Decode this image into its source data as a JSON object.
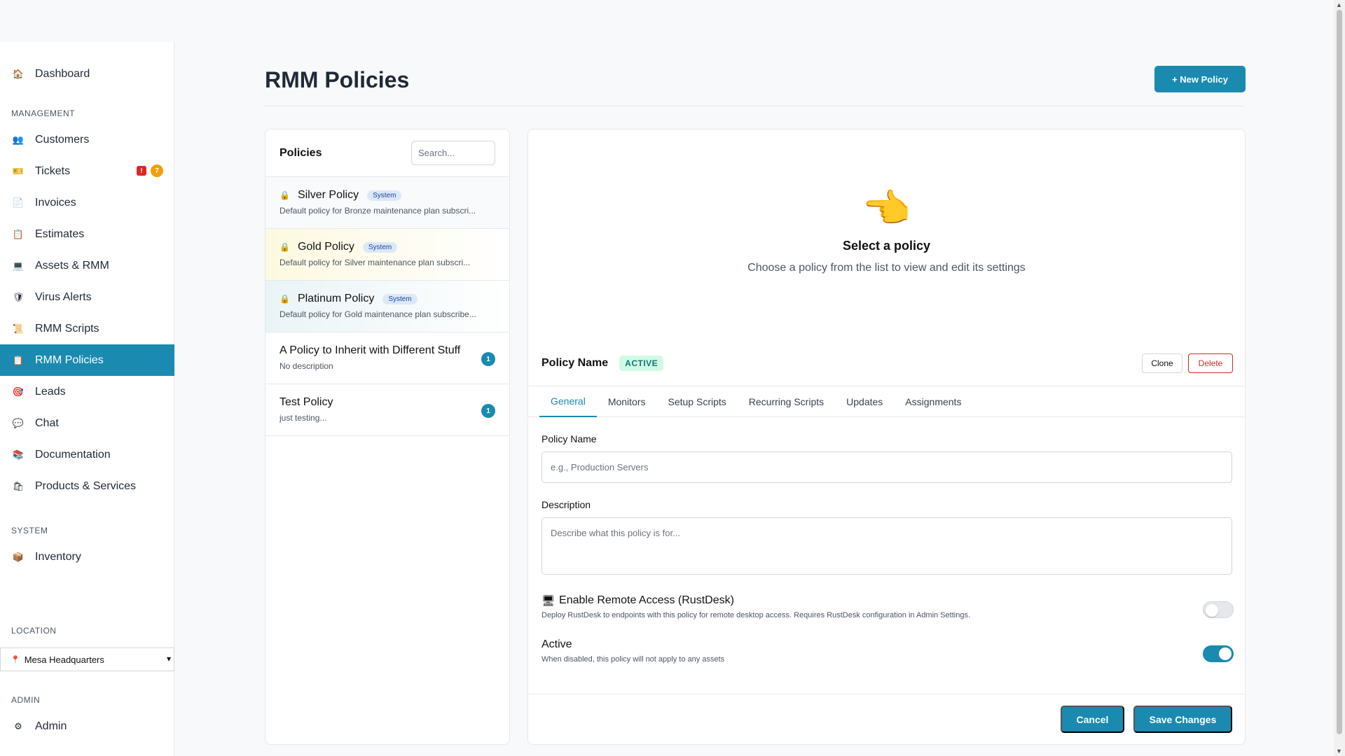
{
  "sidebar": {
    "dashboard": "Dashboard",
    "sections": {
      "management": "MANAGEMENT",
      "system": "SYSTEM",
      "location": "LOCATION",
      "admin": "ADMIN"
    },
    "items": [
      {
        "label": "Customers",
        "icon": "people-icon"
      },
      {
        "label": "Tickets",
        "icon": "ticket-icon"
      },
      {
        "label": "Invoices",
        "icon": "invoice-icon"
      },
      {
        "label": "Estimates",
        "icon": "clipboard-icon"
      },
      {
        "label": "Assets & RMM",
        "icon": "computer-icon"
      },
      {
        "label": "Virus Alerts",
        "icon": "shield-icon"
      },
      {
        "label": "RMM Scripts",
        "icon": "scroll-icon"
      },
      {
        "label": "RMM Policies",
        "icon": "clipboard-icon"
      },
      {
        "label": "Leads",
        "icon": "target-icon"
      },
      {
        "label": "Chat",
        "icon": "chat-icon"
      },
      {
        "label": "Documentation",
        "icon": "books-icon"
      },
      {
        "label": "Products & Services",
        "icon": "shopping-bags-icon"
      }
    ],
    "ticket_badges": {
      "alert": "!",
      "count": "7"
    },
    "inventory": "Inventory",
    "location_value": "Mesa Headquarters",
    "admin_item": "Admin"
  },
  "main": {
    "title": "RMM Policies",
    "new_button": "+ New Policy"
  },
  "policies": {
    "header": "Policies",
    "search_placeholder": "Search...",
    "system_badge": "System",
    "items": [
      {
        "name": "Silver Policy",
        "description": "Default policy for Bronze maintenance plan subscri..."
      },
      {
        "name": "Gold Policy",
        "description": "Default policy for Silver maintenance plan subscri..."
      },
      {
        "name": "Platinum Policy",
        "description": "Default policy for Gold maintenance plan subscribe..."
      },
      {
        "name": "A Policy to Inherit with Different Stuff",
        "description": "No description",
        "count": "1"
      },
      {
        "name": "Test Policy",
        "description": "just testing...",
        "count": "1"
      }
    ]
  },
  "detail": {
    "empty_title": "Select a policy",
    "empty_subtitle": "Choose a policy from the list to view and edit its settings",
    "policy_name": "Policy Name",
    "status": "ACTIVE",
    "clone": "Clone",
    "delete": "Delete",
    "tabs": [
      "General",
      "Monitors",
      "Setup Scripts",
      "Recurring Scripts",
      "Updates",
      "Assignments"
    ],
    "name_label": "Policy Name",
    "name_placeholder": "e.g., Production Servers",
    "description_label": "Description",
    "description_placeholder": "Describe what this policy is for...",
    "remote_title": "Enable Remote Access (RustDesk)",
    "remote_desc": "Deploy RustDesk to endpoints with this policy for remote desktop access. Requires RustDesk configuration in Admin Settings.",
    "remote_enabled": false,
    "active_title": "Active",
    "active_desc": "When disabled, this policy will not apply to any assets",
    "active_enabled": true,
    "cancel": "Cancel",
    "save": "Save Changes"
  },
  "colors": {
    "accent": "#1a8ab0",
    "danger": "#dc2626",
    "badge_orange": "#f59e0b"
  }
}
